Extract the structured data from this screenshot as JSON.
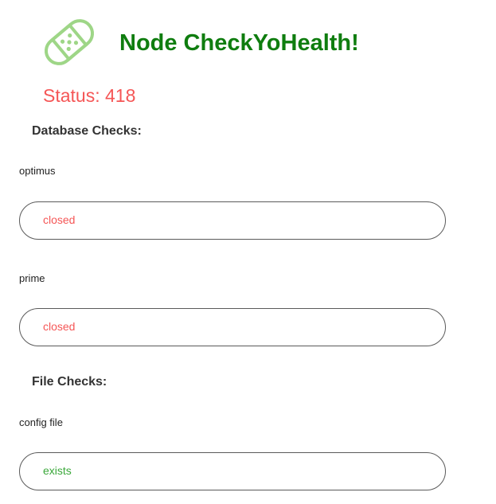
{
  "header": {
    "logo_icon": "bandage-icon",
    "title": "Node CheckYoHealth!",
    "title_color": "#0f7d0f"
  },
  "status": {
    "text": "Status: 418",
    "color": "#f55656"
  },
  "database_checks": {
    "heading": "Database Checks:",
    "items": [
      {
        "name": "optimus",
        "value": "closed",
        "value_color": "#f55656"
      },
      {
        "name": "prime",
        "value": "closed",
        "value_color": "#f55656"
      }
    ]
  },
  "file_checks": {
    "heading": "File Checks:",
    "items": [
      {
        "name": "config file",
        "value": "exists",
        "value_color": "#3aa83a"
      }
    ]
  },
  "colors": {
    "logo": "#9ed687",
    "pill_border": "#5a5a5a"
  }
}
